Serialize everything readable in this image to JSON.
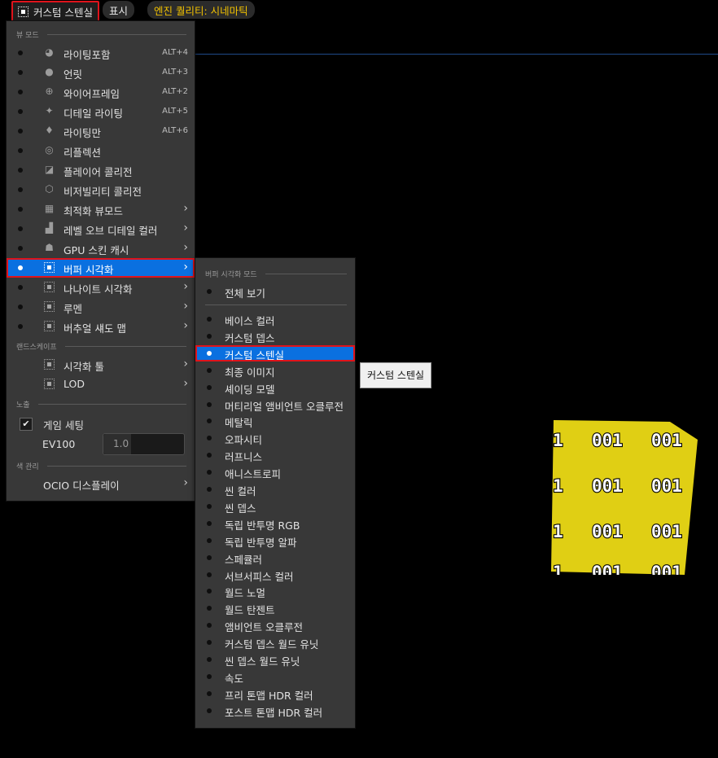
{
  "toolbar": {
    "view_mode": "커스텀 스텐실",
    "show": "표시",
    "engine_quality": "엔진 퀄리티: 시네마틱"
  },
  "main_menu": {
    "section_view_mode": "뷰 모드",
    "items": [
      {
        "label": "라이팅포함",
        "shortcut": "ALT+4",
        "icon": "sphere-lit-icon"
      },
      {
        "label": "언릿",
        "shortcut": "ALT+3",
        "icon": "sphere-unlit-icon"
      },
      {
        "label": "와이어프레임",
        "shortcut": "ALT+2",
        "icon": "wireframe-globe-icon"
      },
      {
        "label": "디테일 라이팅",
        "shortcut": "ALT+5",
        "icon": "detail-lighting-icon"
      },
      {
        "label": "라이팅만",
        "shortcut": "ALT+6",
        "icon": "bulb-icon"
      },
      {
        "label": "리플렉션",
        "shortcut": "",
        "icon": "reflection-icon"
      },
      {
        "label": "플레이어 콜리전",
        "shortcut": "",
        "icon": "player-collision-icon"
      },
      {
        "label": "비저빌리티 콜리전",
        "shortcut": "",
        "icon": "visibility-collision-icon"
      },
      {
        "label": "최적화 뷰모드",
        "shortcut": "",
        "icon": "grid-icon"
      },
      {
        "label": "레벨 오브 디테일 컬러",
        "shortcut": "",
        "icon": "lod-color-icon"
      },
      {
        "label": "GPU 스킨 캐시",
        "shortcut": "",
        "icon": "skin-cache-icon"
      },
      {
        "label": "버퍼 시각화",
        "shortcut": "",
        "icon": "buffer-icon"
      },
      {
        "label": "나나이트 시각화",
        "shortcut": "",
        "icon": "nanite-icon"
      },
      {
        "label": "루멘",
        "shortcut": "",
        "icon": "lumen-icon"
      },
      {
        "label": "버추얼 섀도 맵",
        "shortcut": "",
        "icon": "shadow-map-icon"
      }
    ],
    "section_landscape": "랜드스케이프",
    "landscape_items": [
      {
        "label": "시각화 툴",
        "icon": "viz-tool-icon"
      },
      {
        "label": "LOD",
        "icon": "lod-icon"
      }
    ],
    "section_exposure": "노출",
    "game_settings": "게임 세팅",
    "ev100_label": "EV100",
    "ev100_value": "1.0",
    "section_color": "색 관리",
    "ocio": "OCIO 디스플레이"
  },
  "sub_menu": {
    "section": "버퍼 시각화 모드",
    "overview": "전체 보기",
    "items": [
      "베이스 컬러",
      "커스텀 뎁스",
      "커스텀 스텐실",
      "최종 이미지",
      "셰이딩 모델",
      "머티리얼 앰비언트 오클루전",
      "메탈릭",
      "오파시티",
      "러프니스",
      "애니스트로피",
      "씬 컬러",
      "씬 뎁스",
      "독립 반투명 RGB",
      "독립 반투명 알파",
      "스페큘러",
      "서브서피스 컬러",
      "월드 노멀",
      "월드 탄젠트",
      "앰비언트 오클루전",
      "커스텀 뎁스 월드 유닛",
      "씬 뎁스 월드 유닛",
      "속도",
      "프리 톤맵 HDR 컬러",
      "포스트 톤맵 HDR 컬러"
    ]
  },
  "tooltip": "커스텀 스텐실",
  "viewport": {
    "stencil_text": "001",
    "stencil_edge": "1",
    "cube_color": "#e0cf14"
  }
}
